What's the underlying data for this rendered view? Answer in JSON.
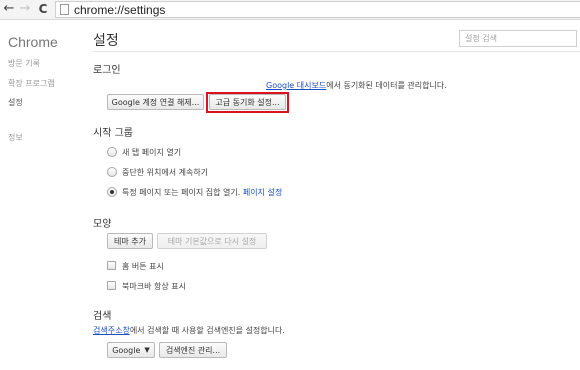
{
  "browser": {
    "url": "chrome://settings"
  },
  "sidebar": {
    "title": "Chrome",
    "items": [
      {
        "label": "방문 기록"
      },
      {
        "label": "확장 프로그램"
      },
      {
        "label": "설정"
      },
      {
        "label": "정보"
      }
    ]
  },
  "header": {
    "title": "설정",
    "search_placeholder": "설정 검색"
  },
  "signin": {
    "title": "로그인",
    "desc_link": "Google 대시보드",
    "desc_rest": "에서 동기화된 데이터를 관리합니다.",
    "disconnect_button": "Google 계정 연결 해제...",
    "advanced_sync_button": "고급 동기화 설정..."
  },
  "startup": {
    "title": "시작 그룹",
    "options": [
      {
        "label": "새 탭 페이지 열기",
        "checked": false
      },
      {
        "label": "중단한 위치에서 계속하기",
        "checked": false
      },
      {
        "label": "특정 페이지 또는 페이지 집합 열기.",
        "checked": true
      }
    ],
    "set_pages_link": "페이지 설정"
  },
  "appearance": {
    "title": "모양",
    "theme_button": "테마 추가",
    "reset_theme_button": "테마 기본값으로 다시 설정",
    "show_home_button": "홈 버튼 표시",
    "always_show_bookmarks": "북마크바 항상 표시"
  },
  "search": {
    "title": "검색",
    "desc_link": "검색주소창",
    "desc_rest": "에서 검색할 때 사용할 검색엔진을 설정합니다.",
    "engine_selected": "Google",
    "manage_button": "검색엔진 관리..."
  }
}
